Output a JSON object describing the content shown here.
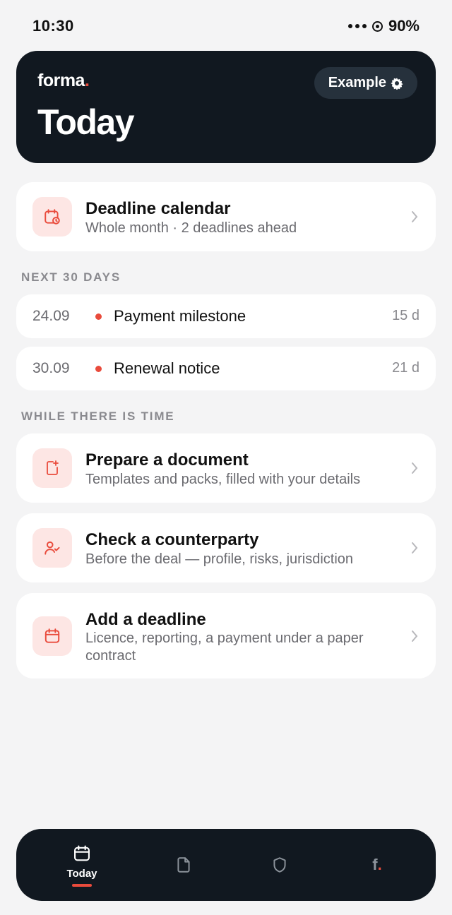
{
  "status": {
    "time": "10:30",
    "battery": "90%"
  },
  "header": {
    "brand": "forma",
    "brand_dot": ".",
    "title": "Today",
    "example_label": "Example",
    "example_icon": "gear-icon"
  },
  "calendar_card": {
    "title": "Deadline calendar",
    "subtitle": "Whole month · 2 deadlines ahead",
    "icon": "calendar-clock-icon"
  },
  "next_section": {
    "label": "NEXT 30 DAYS",
    "items": [
      {
        "date": "24.09",
        "title": "Payment milestone",
        "days": "15 d"
      },
      {
        "date": "30.09",
        "title": "Renewal notice",
        "days": "21 d"
      }
    ]
  },
  "while_section": {
    "label": "WHILE THERE IS TIME",
    "items": [
      {
        "title": "Prepare a document",
        "subtitle": "Templates and packs, filled with your details",
        "icon": "document-plus-icon"
      },
      {
        "title": "Check a counterparty",
        "subtitle": "Before the deal — profile, risks, jurisdiction",
        "icon": "user-check-icon"
      },
      {
        "title": "Add a deadline",
        "subtitle": "Licence, reporting, a payment under a paper contract",
        "icon": "calendar-icon"
      }
    ]
  },
  "nav": {
    "items": [
      {
        "label": "Today",
        "icon": "calendar-icon",
        "active": true
      },
      {
        "label": "",
        "icon": "document-icon",
        "active": false
      },
      {
        "label": "",
        "icon": "shield-icon",
        "active": false
      },
      {
        "label": "f",
        "icon": "brand-icon",
        "active": false
      }
    ]
  },
  "colors": {
    "accent": "#e94b3c",
    "dark": "#111820",
    "background": "#f4f4f5"
  }
}
